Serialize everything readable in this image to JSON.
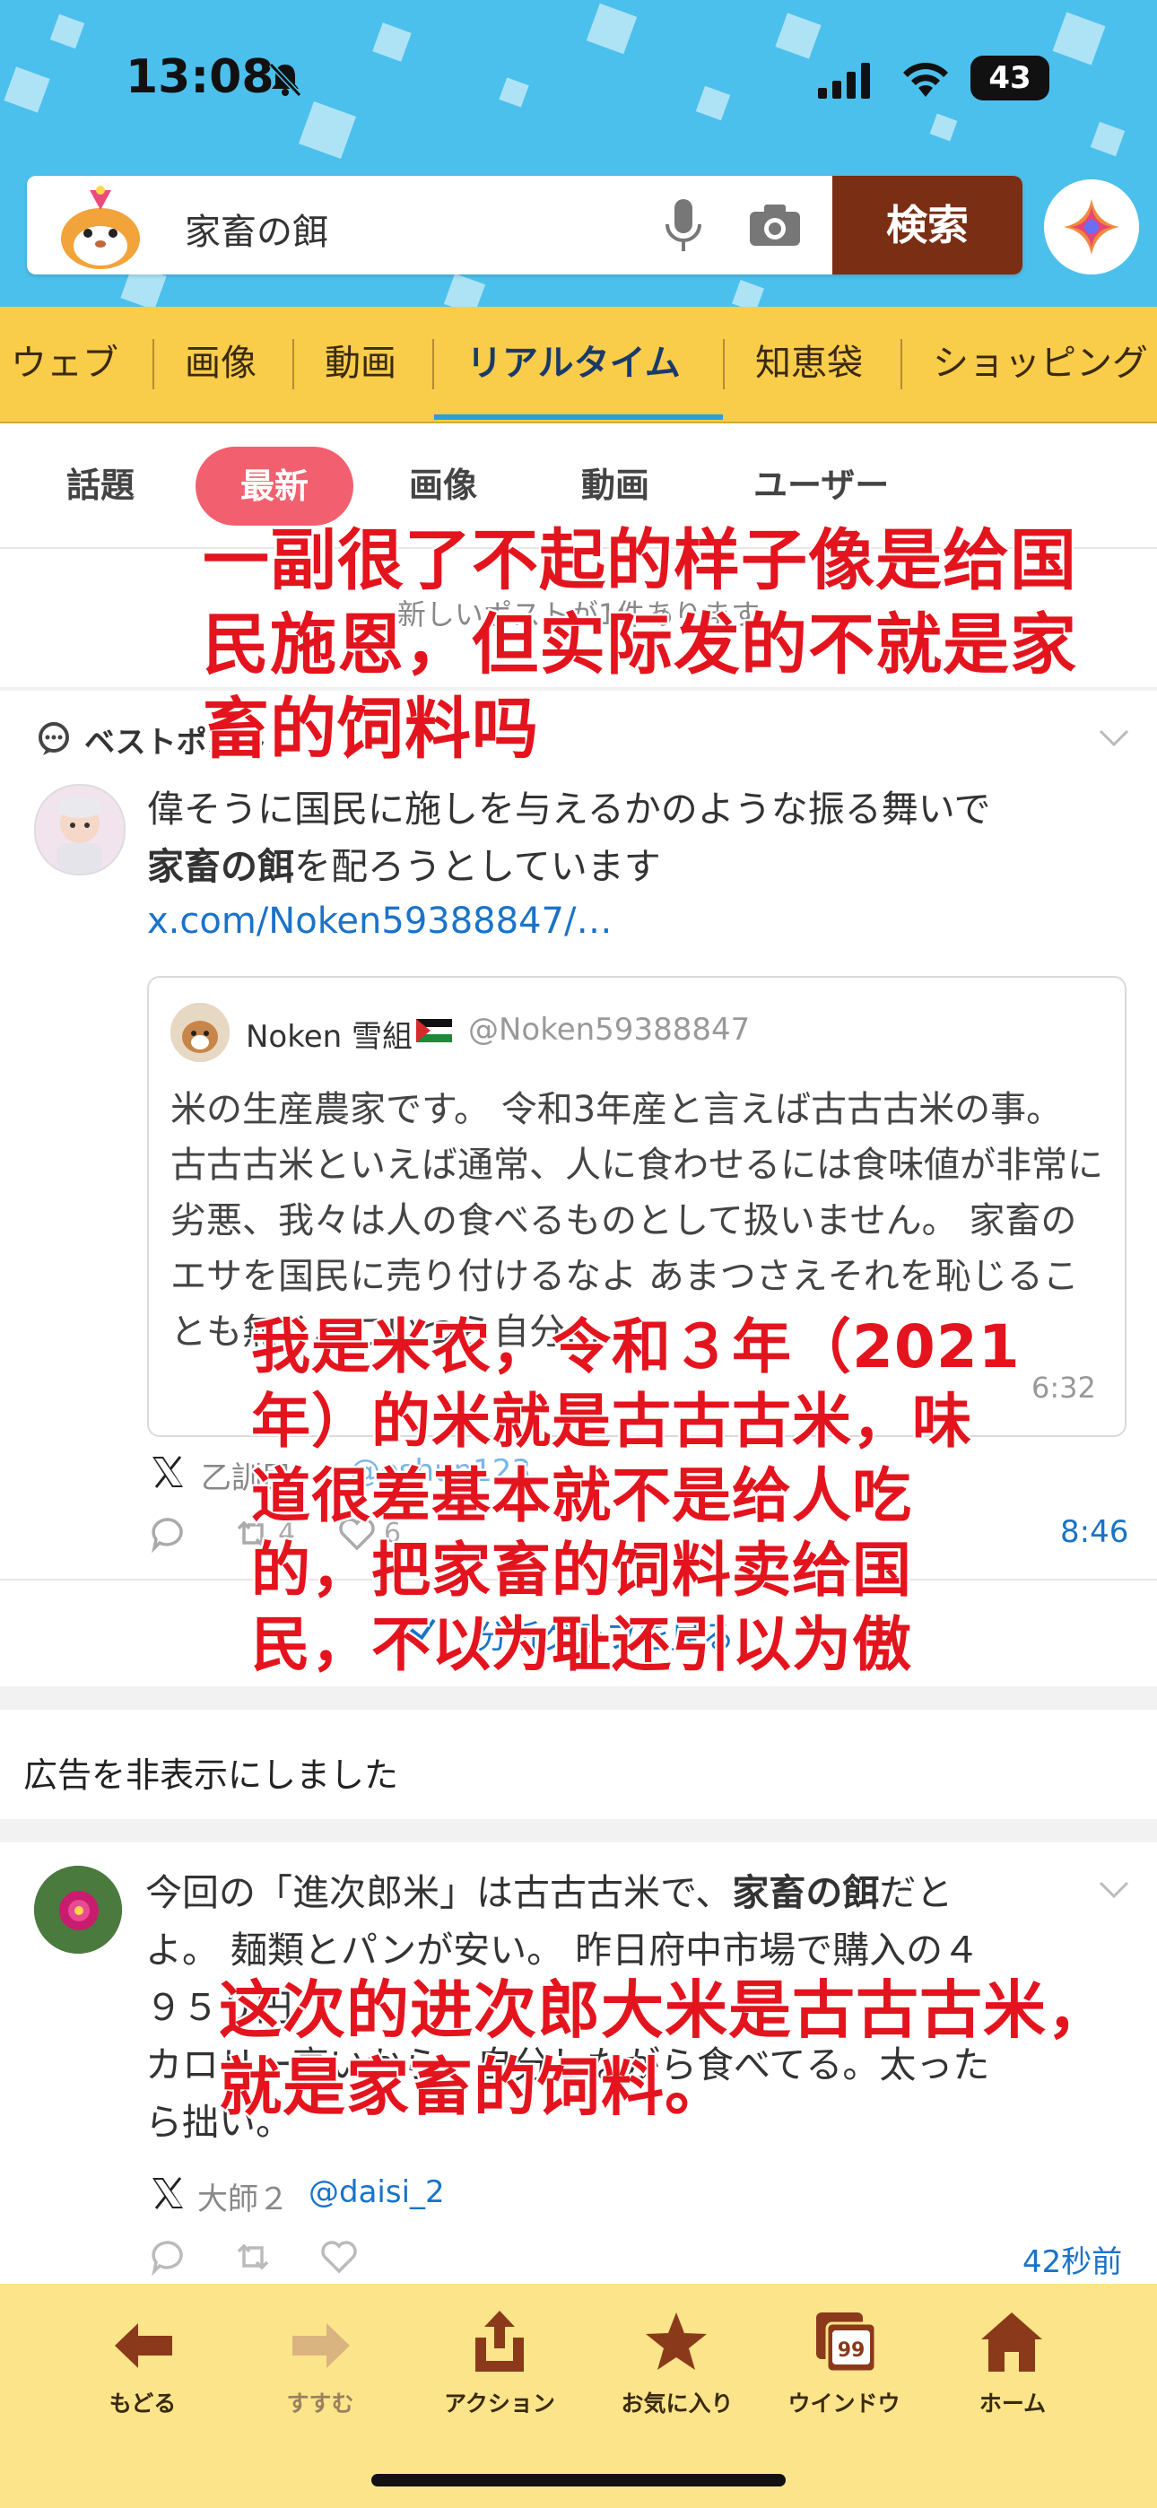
{
  "status_bar": {
    "time": "13:08",
    "battery": "43"
  },
  "search": {
    "query": "家畜の餌",
    "button_label": "検索"
  },
  "category_tabs": [
    "ウェブ",
    "画像",
    "動画",
    "リアルタイム",
    "知恵袋",
    "ショッピング"
  ],
  "sub_tabs": [
    "話題",
    "最新",
    "画像",
    "動画",
    "ユーザー"
  ],
  "new_posts_notice": "新しいポストが1件あります",
  "best_post_label": "ベストポスト",
  "post1": {
    "line1": "偉そうに国民に施しを与えるかのような振る舞いで",
    "bold_term": "家畜の餌",
    "line2_rest": "を配ろうとしています",
    "link": "x.com/Noken59388847/…",
    "quote": {
      "name": "Noken 雪組",
      "handle": "@Noken59388847",
      "text": "米の生産農家です。 令和3年産と言えば古古古米の事。 古古古米といえば通常、人に食わせるには食味値が非常に劣悪、我々は人の食べるものとして扱いません。 家畜のエサを国民に売り付けるなよ あまつさえそれを恥じることも無く、こいつら自分…",
      "time": "6:32"
    },
    "author": "乙訓民",
    "handle": "@oshun123",
    "repost_count": "4",
    "like_count": "6",
    "time": "8:46",
    "analytics": "分析グラフを見る"
  },
  "ad_hidden": "広告を非表示にしました",
  "post2": {
    "line1_pre": "今回の「進次郎米」は古古古米で、",
    "bold_term": "家畜の餌",
    "line1_post": "だと",
    "line2": "よ。 麺類とパンが安い。 昨日府中市場で購入の４",
    "line3": "９５０円",
    "line4": "カロリー高いから、自分しながら食べてる。太った",
    "line5": "ら拙い。",
    "author": "大師２",
    "handle": "@daisi_2",
    "time": "42秒前"
  },
  "toolbar": [
    "もどる",
    "すすむ",
    "アクション",
    "お気に入り",
    "ウインドウ",
    "ホーム"
  ],
  "window_count": "99",
  "overlays": {
    "top": "一副很了不起的样子像是给国民施恩，但实际发的不就是家畜的饲料吗",
    "middle": "我是米农，令和３年（2021年）的米就是古古古米，味道很差基本就不是给人吃的，把家畜的饲料卖给国民，不以为耻还引以为傲",
    "bottom": "这次的进次郎大米是古古古米，就是家畜的饲料。"
  },
  "colors": {
    "header_blue": "#4cc0ec",
    "tab_yellow": "#f9cc4a",
    "search_button": "#7a2e14",
    "active_pill": "#f2606f",
    "link_blue": "#1a73c8",
    "overlay_red": "#e3141d",
    "toolbar_yellow": "#fbe48a"
  }
}
